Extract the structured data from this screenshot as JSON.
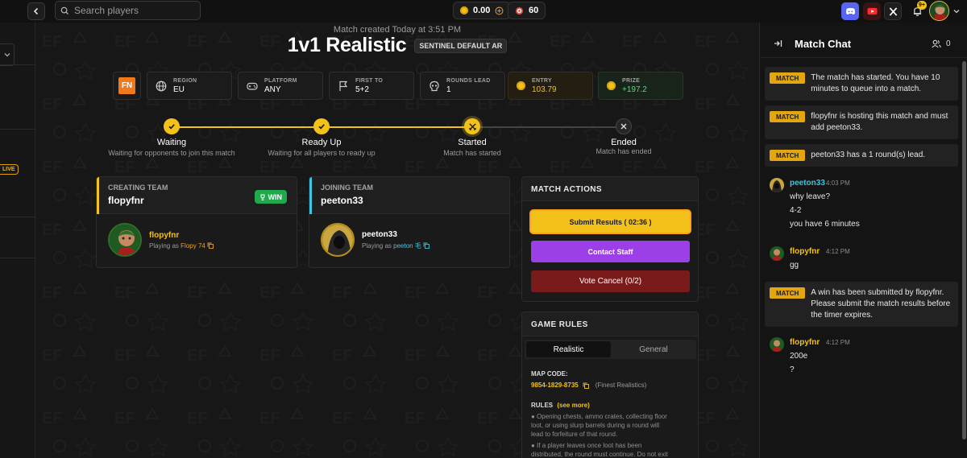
{
  "topbar": {
    "search_placeholder": "Search players",
    "balance": "0.00",
    "tokens": "60",
    "notif_count": "9+"
  },
  "leftnav": {
    "live_label": "LIVE"
  },
  "match": {
    "created": "Match created Today at 3:51 PM",
    "title": "1v1 Realistic",
    "mode_badge": "SENTINEL DEFAULT AR",
    "game_logo": "FN",
    "info": [
      {
        "label": "REGION",
        "value": "EU",
        "icon": "globe-icon"
      },
      {
        "label": "PLATFORM",
        "value": "ANY",
        "icon": "gamepad-icon"
      },
      {
        "label": "FIRST TO",
        "value": "5+2",
        "icon": "flag-icon"
      },
      {
        "label": "ROUNDS LEAD",
        "value": "1",
        "icon": "skull-icon"
      },
      {
        "label": "ENTRY",
        "value": "103.79",
        "icon": "coin-icon"
      },
      {
        "label": "PRIZE",
        "value": "+197.2",
        "icon": "coin-icon"
      }
    ]
  },
  "steps": [
    {
      "label": "Waiting",
      "sub": "Waiting for opponents to join this match"
    },
    {
      "label": "Ready Up",
      "sub": "Waiting for all players to ready up"
    },
    {
      "label": "Started",
      "sub": "Match has started"
    },
    {
      "label": "Ended",
      "sub": "Match has ended"
    }
  ],
  "teams": {
    "creating": {
      "heading": "CREATING TEAM",
      "name": "flopyfnr",
      "badge": "WIN",
      "player": "flopyfnr",
      "playing_prefix": "Playing as",
      "handle": "Flopy 74"
    },
    "joining": {
      "heading": "JOINING TEAM",
      "name": "peeton33",
      "player": "peeton33",
      "playing_prefix": "Playing as",
      "handle": "peeton 毛"
    }
  },
  "actions": {
    "heading": "MATCH ACTIONS",
    "submit": "Submit Results (  02:36  )",
    "contact": "Contact Staff",
    "vote": "Vote Cancel (0/2)"
  },
  "rules": {
    "heading": "GAME RULES",
    "tabs": [
      "Realistic",
      "General"
    ],
    "map_code_label": "MAP CODE:",
    "map_code": "9854-1829-8735",
    "map_name": "(Finest Realistics)",
    "rules_label": "RULES",
    "see_more": "(see more)",
    "rule1": [
      "● Opening chests, ammo crates, collecting floor",
      "loot, or using slurp barrels during a round will",
      "lead to forfeiture of that round."
    ],
    "rule2": [
      "● If a player leaves once loot has been",
      "distributed, the round must continue. Do not exit"
    ]
  },
  "chat": {
    "title": "Match Chat",
    "users": "0",
    "tag": "MATCH",
    "sys1": "The match has started. You have 10 minutes to queue into a match.",
    "sys2": "flopyfnr is hosting this match and must add peeton33.",
    "sys3": "peeton33 has a 1 round(s) lead.",
    "msg1": {
      "name": "peeton33",
      "time": "4:03 PM",
      "lines": [
        "why leave?",
        "4-2",
        "you have 6 minutes"
      ]
    },
    "msg2": {
      "name": "flopyfnr",
      "time": "4:12 PM",
      "lines": [
        "gg"
      ]
    },
    "sys4": "A win has been submitted by flopyfnr. Please submit the match results before the timer expires.",
    "msg3": {
      "name": "flopyfnr",
      "time": "4:12 PM",
      "lines": [
        "200e",
        "?"
      ]
    }
  },
  "colors": {
    "accent_yellow": "#f2c21a",
    "purple": "#9b3fe6",
    "red": "#7a1b1b",
    "green": "#1fa84c",
    "cyan": "#3cc6e6"
  }
}
